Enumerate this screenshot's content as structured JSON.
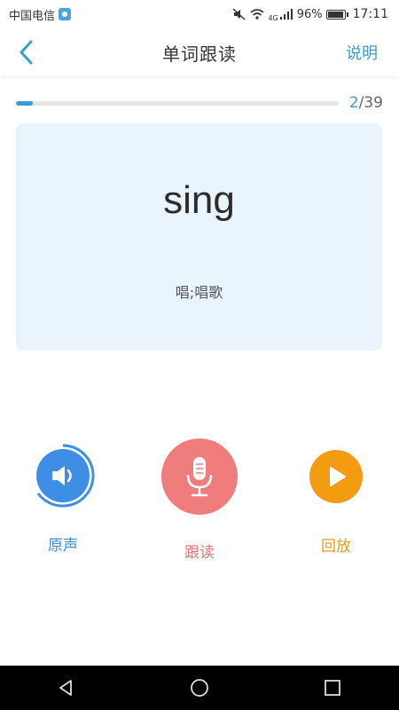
{
  "status_bar": {
    "carrier": "中国电信",
    "battery": "96%",
    "time": "17:11",
    "network": "4G",
    "icons": [
      "carrier-badge-icon",
      "mute-icon",
      "wifi-icon",
      "signal-icon",
      "battery-icon"
    ]
  },
  "header": {
    "title": "单词跟读",
    "help_label": "说明",
    "back_icon": "chevron-left-icon"
  },
  "progress": {
    "current": "2",
    "separator_total": "/39",
    "fraction": 0.051
  },
  "word": {
    "text": "sing",
    "meaning": "唱;唱歌"
  },
  "controls": {
    "original": {
      "label": "原声",
      "icon": "speaker-icon",
      "color": "#3f8ee6",
      "label_color": "#3a8fd6"
    },
    "follow": {
      "label": "跟读",
      "icon": "microphone-icon",
      "color": "#f07d7d",
      "label_color": "#e07a7a"
    },
    "playback": {
      "label": "回放",
      "icon": "play-icon",
      "color": "#f39c12",
      "label_color": "#e0a019"
    }
  },
  "nav": {
    "icons": [
      "back-triangle-icon",
      "home-circle-icon",
      "recents-square-icon"
    ]
  },
  "colors": {
    "accent": "#3a9bd6",
    "card_bg": "#e9f4fd"
  }
}
